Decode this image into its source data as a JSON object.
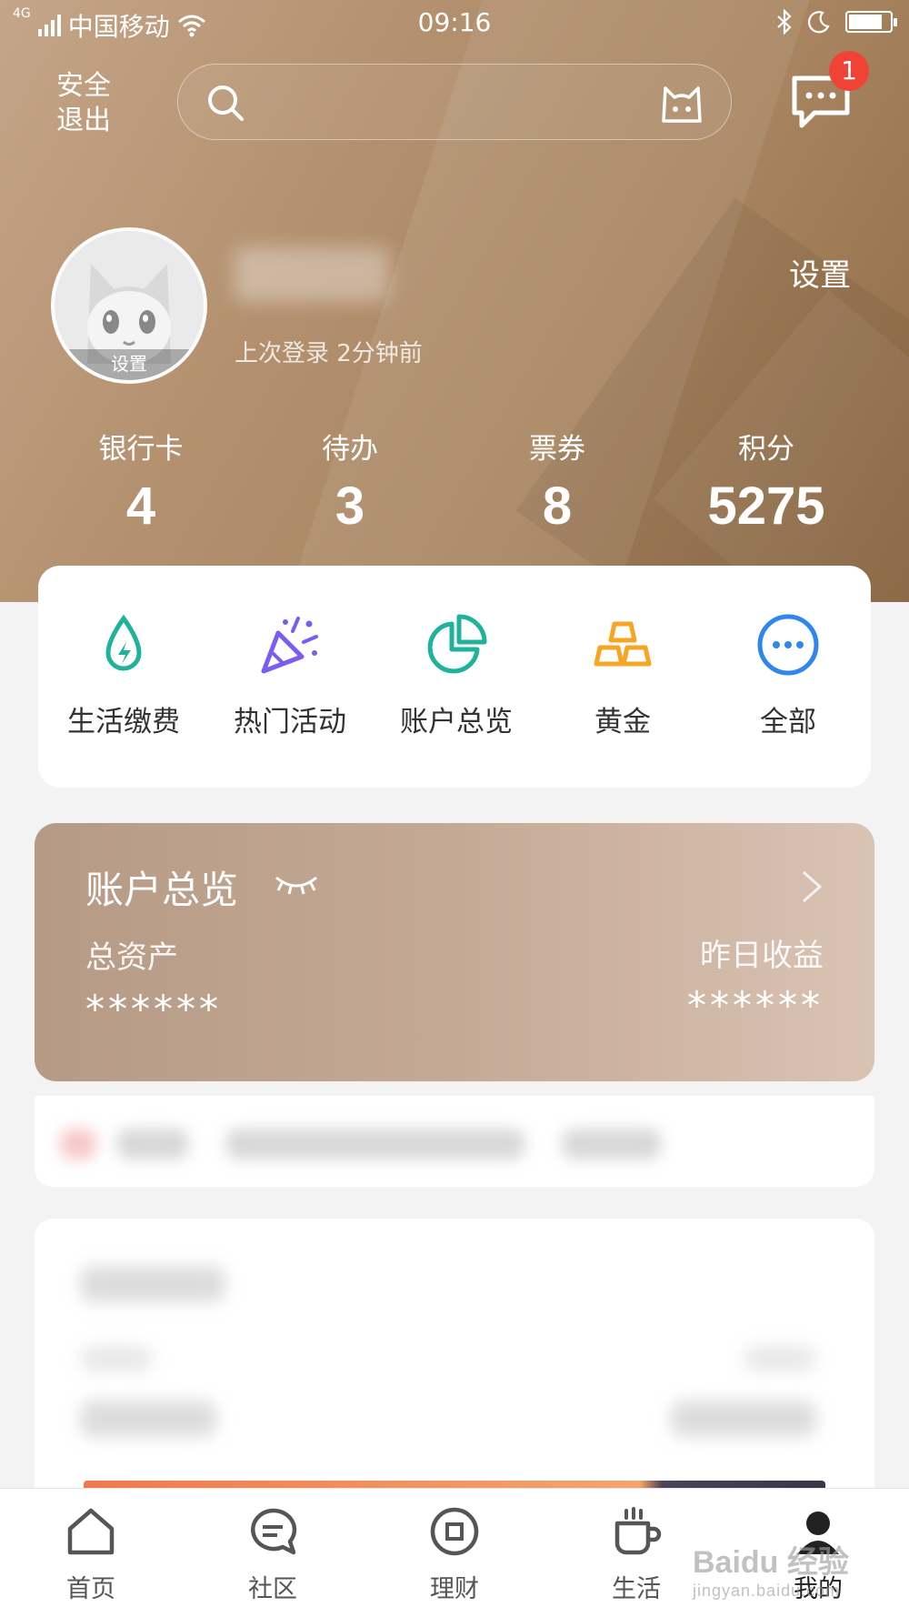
{
  "status_bar": {
    "network_type": "4G",
    "carrier": "中国移动",
    "time": "09:16"
  },
  "header": {
    "logout_label": "安全\n退出",
    "notification_count": "1"
  },
  "profile": {
    "avatar_label": "设置",
    "last_login": "上次登录 2分钟前",
    "settings_label": "设置"
  },
  "stats": [
    {
      "label": "银行卡",
      "value": "4"
    },
    {
      "label": "待办",
      "value": "3"
    },
    {
      "label": "票券",
      "value": "8"
    },
    {
      "label": "积分",
      "value": "5275"
    }
  ],
  "quick_actions": [
    {
      "label": "生活缴费",
      "icon": "drop-bolt-icon",
      "color": "#1fb39c"
    },
    {
      "label": "热门活动",
      "icon": "party-popper-icon",
      "color": "#7a5cf0"
    },
    {
      "label": "账户总览",
      "icon": "pie-chart-icon",
      "color": "#1fb39c"
    },
    {
      "label": "黄金",
      "icon": "gold-bars-icon",
      "color": "#f5a623"
    },
    {
      "label": "全部",
      "icon": "more-dots-icon",
      "color": "#2e86ee"
    }
  ],
  "account_overview": {
    "title": "账户总览",
    "total_assets_label": "总资产",
    "total_assets_value": "******",
    "yesterday_income_label": "昨日收益",
    "yesterday_income_value": "******"
  },
  "tabbar": [
    {
      "label": "首页",
      "icon": "home-icon"
    },
    {
      "label": "社区",
      "icon": "chat-bubble-icon"
    },
    {
      "label": "理财",
      "icon": "wealth-coin-icon"
    },
    {
      "label": "生活",
      "icon": "coffee-cup-icon"
    },
    {
      "label": "我的",
      "icon": "user-icon",
      "active": true
    }
  ],
  "watermark": {
    "brand": "Baidu 经验",
    "url": "jingyan.baidu.com"
  },
  "colors": {
    "hero": "#b08d68",
    "badge": "#f04336",
    "card_bg": "#ffffff"
  }
}
